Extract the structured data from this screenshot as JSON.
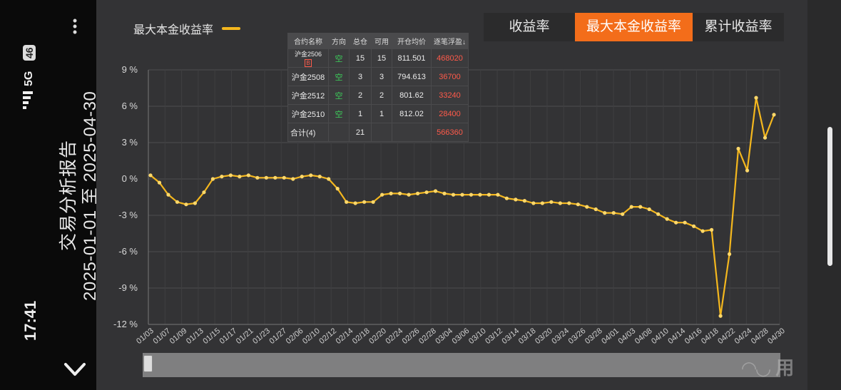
{
  "status": {
    "time": "17:41",
    "network": "5G",
    "badge": "46"
  },
  "header": {
    "title": "交易分析报告",
    "date_range": "2025-01-01 至 2025-04-30"
  },
  "legend": {
    "label": "最大本金收益率"
  },
  "tabs": [
    {
      "label": "收益率",
      "active": false
    },
    {
      "label": "最大本金收益率",
      "active": true
    },
    {
      "label": "累计收益率",
      "active": false
    }
  ],
  "holdings": {
    "headers": [
      "合约名称",
      "方向",
      "总仓",
      "可用",
      "开仓均价",
      "逐笔浮盈↓"
    ],
    "rows": [
      {
        "name": "沪金2506",
        "badge": "B",
        "dir": "空",
        "total": "15",
        "avail": "15",
        "price": "811.501",
        "pnl": "468020"
      },
      {
        "name": "沪金2508",
        "badge": "",
        "dir": "空",
        "total": "3",
        "avail": "3",
        "price": "794.613",
        "pnl": "36700"
      },
      {
        "name": "沪金2512",
        "badge": "",
        "dir": "空",
        "total": "2",
        "avail": "2",
        "price": "801.62",
        "pnl": "33240"
      },
      {
        "name": "沪金2510",
        "badge": "",
        "dir": "空",
        "total": "1",
        "avail": "1",
        "price": "812.02",
        "pnl": "28400"
      }
    ],
    "summary": {
      "name": "合计(4)",
      "total": "21",
      "pnl": "566360"
    }
  },
  "colors": {
    "accent": "#f36d1a",
    "line": "#f4b71e",
    "background": "#333335",
    "profit_red": "#ff5a4a",
    "short_green": "#3ccf5a"
  },
  "chart_data": {
    "type": "line",
    "ylim": [
      -12,
      9
    ],
    "yticks": [
      "9 %",
      "6 %",
      "3 %",
      "0 %",
      "-3 %",
      "-6 %",
      "-9 %",
      "-12 %"
    ],
    "ytick_values": [
      9,
      6,
      3,
      0,
      -3,
      -6,
      -9,
      -12
    ],
    "xtick_labels": [
      "01/03",
      "01/07",
      "01/09",
      "01/13",
      "01/15",
      "01/17",
      "01/21",
      "01/23",
      "01/27",
      "02/06",
      "02/10",
      "02/12",
      "02/14",
      "02/18",
      "02/20",
      "02/24",
      "02/26",
      "02/28",
      "03/04",
      "03/06",
      "03/10",
      "03/12",
      "03/14",
      "03/18",
      "03/20",
      "03/24",
      "03/26",
      "03/28",
      "04/01",
      "04/03",
      "04/08",
      "04/10",
      "04/14",
      "04/16",
      "04/18",
      "04/22",
      "04/24",
      "04/28",
      "04/30"
    ],
    "series": [
      {
        "values": [
          0.3,
          -0.3,
          -1.3,
          -1.9,
          -2.1,
          -2.0,
          -1.1,
          0.0,
          0.2,
          0.3,
          0.2,
          0.3,
          0.1,
          0.1,
          0.1,
          0.1,
          0.0,
          0.2,
          0.3,
          0.2,
          0.0,
          -0.8,
          -1.9,
          -2.0,
          -1.9,
          -1.9,
          -1.3,
          -1.2,
          -1.2,
          -1.3,
          -1.2,
          -1.1,
          -1.0,
          -1.2,
          -1.3,
          -1.3,
          -1.3,
          -1.3,
          -1.3,
          -1.3,
          -1.6,
          -1.7,
          -1.8,
          -2.0,
          -2.0,
          -1.9,
          -2.0,
          -2.0,
          -2.1,
          -2.3,
          -2.5,
          -2.8,
          -2.8,
          -2.9,
          -2.3,
          -2.3,
          -2.5,
          -2.9,
          -3.3,
          -3.6,
          -3.6,
          -3.9,
          -4.3,
          -4.2,
          -11.3,
          -6.2,
          2.5,
          0.7,
          6.7,
          3.4,
          5.3
        ]
      }
    ],
    "grid": true,
    "legend_position": "top-left"
  }
}
